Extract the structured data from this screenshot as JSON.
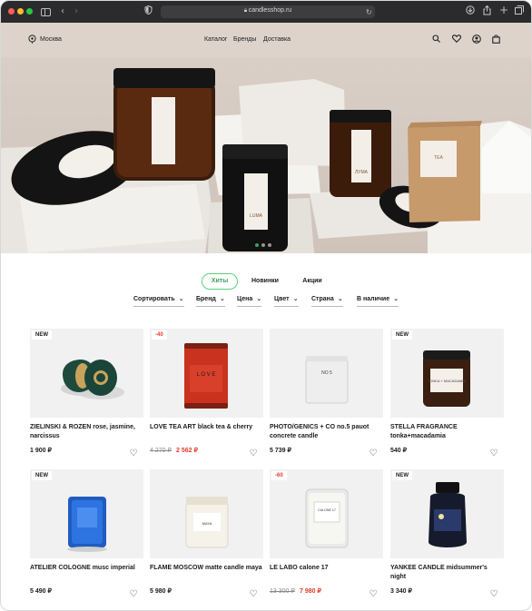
{
  "browser": {
    "url": "candlesshop.ru"
  },
  "header": {
    "city": "Москва",
    "nav": [
      "Каталог",
      "Бренды",
      "Доставка"
    ]
  },
  "tabs": [
    {
      "label": "Хиты",
      "active": true
    },
    {
      "label": "Новинки",
      "active": false
    },
    {
      "label": "Акции",
      "active": false
    }
  ],
  "filters": [
    "Сортировать",
    "Бренд",
    "Цена",
    "Цвет",
    "Страна",
    "В наличие"
  ],
  "products": [
    {
      "badge": "NEW",
      "name": "ZIELINSKI & ROZEN rose, jasmine, narcissus",
      "price": "1 900 ₽"
    },
    {
      "badge": "-40",
      "name": "LOVE TEA ART black tea & cherry",
      "old_price": "4 270 ₽",
      "price": "2 562 ₽"
    },
    {
      "badge": "",
      "name": "PHOTO/GENICS + CO no.5 pauot concrete candle",
      "price": "5 739 ₽"
    },
    {
      "badge": "NEW",
      "name": "STELLA FRAGRANCE tonka+macadamia",
      "price": "540 ₽"
    },
    {
      "badge": "NEW",
      "name": "ATELIER COLOGNE musc imperial",
      "price": "5 490 ₽"
    },
    {
      "badge": "",
      "name": "FLAME MOSCOW matte candle maya",
      "price": "5 980 ₽"
    },
    {
      "badge": "-60",
      "name": "LE LABO calone 17",
      "old_price": "13 300 ₽",
      "price": "7 980 ₽"
    },
    {
      "badge": "NEW",
      "name": "YANKEE CANDLE midsummer's night",
      "price": "3 340 ₽"
    }
  ],
  "hero": {
    "slides": 3,
    "active_slide": 1,
    "label_luma": "LUMA",
    "label_jar": "ЛУМА",
    "label_box": "ТЕА"
  },
  "product_labels": {
    "love": "L O V E",
    "no5": "NO 5",
    "tonka": "TONKA + MACADAMIA",
    "maya": "MAYA",
    "lelabo": "CALONE 17"
  },
  "icons": [
    "location-pin-icon",
    "search-icon",
    "heart-icon",
    "user-icon",
    "bag-icon"
  ]
}
